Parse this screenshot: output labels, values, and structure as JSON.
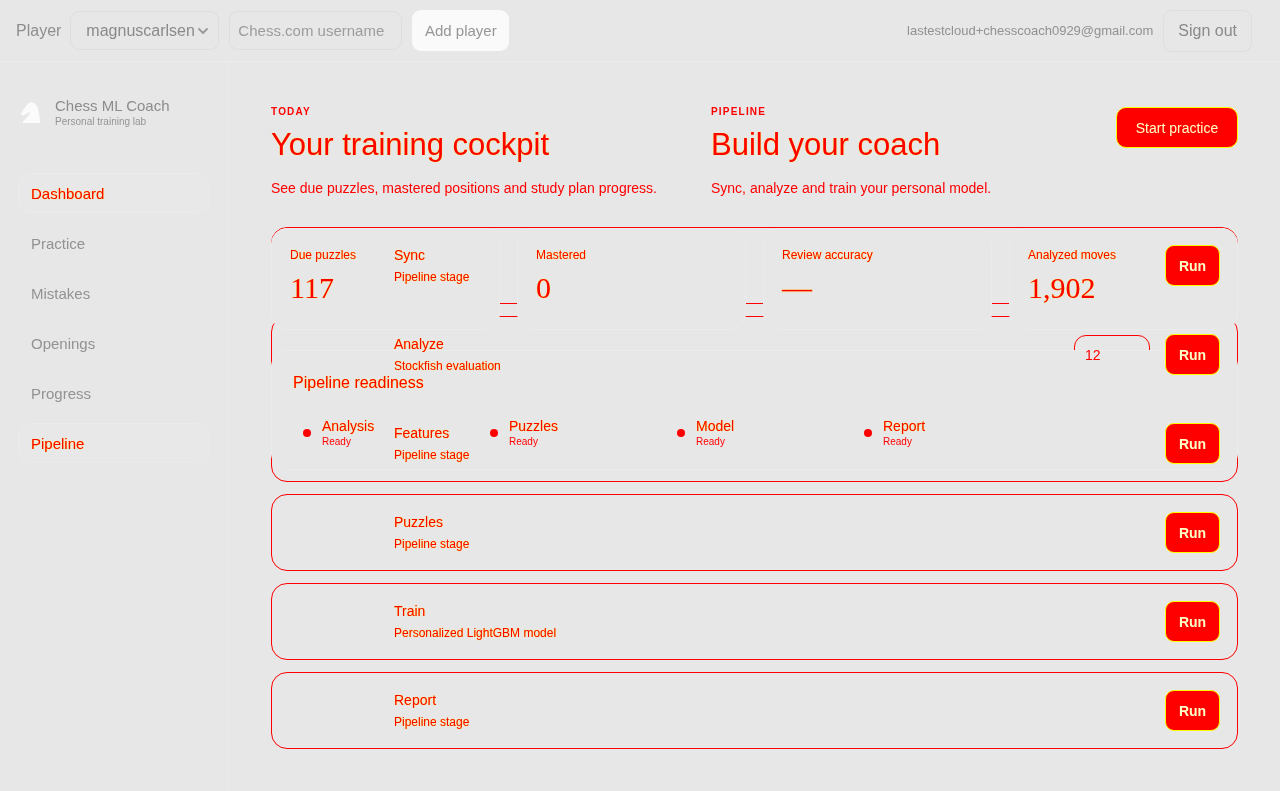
{
  "topbar": {
    "player_label": "Player",
    "player_select": {
      "value": "magnuscarlsen"
    },
    "username_field": {
      "placeholder": "Chess.com username"
    },
    "add_button": "Add player",
    "account_email": "lastestcloud+chesscoach0929@gmail.com",
    "sign_out_button": "Sign out"
  },
  "sidebar": {
    "brand": {
      "name": "Chess ML Coach",
      "tagline": "Personal training lab"
    },
    "items": [
      {
        "label": "Dashboard",
        "selected": true
      },
      {
        "label": "Practice",
        "selected": false
      },
      {
        "label": "Mistakes",
        "selected": false
      },
      {
        "label": "Openings",
        "selected": false
      },
      {
        "label": "Progress",
        "selected": false
      },
      {
        "label": "Pipeline",
        "selected": true
      }
    ]
  },
  "pipeline_view": {
    "eyebrow": "PIPELINE",
    "title": "Build your coach",
    "subtitle": "Sync, analyze and train your personal model.",
    "stages": [
      {
        "name": "Sync",
        "description": "Pipeline stage",
        "button": "Run"
      },
      {
        "name": "Analyze",
        "description": "Stockfish evaluation",
        "badge": "12",
        "button": "Run"
      },
      {
        "name": "Features",
        "description": "Pipeline stage",
        "button": "Run"
      },
      {
        "name": "Puzzles",
        "description": "Pipeline stage",
        "button": "Run"
      },
      {
        "name": "Train",
        "description": "Personalized LightGBM model",
        "button": "Run"
      },
      {
        "name": "Report",
        "description": "Pipeline stage",
        "button": "Run"
      }
    ]
  },
  "dashboard_view": {
    "eyebrow": "TODAY",
    "title": "Your training cockpit",
    "subtitle": "See due puzzles, mastered positions and study plan progress.",
    "primary_button": "Start practice",
    "stats": [
      {
        "label": "Due puzzles",
        "value": "117"
      },
      {
        "label": "Mastered",
        "value": "0"
      },
      {
        "label": "Review accuracy",
        "value": "—"
      },
      {
        "label": "Analyzed moves",
        "value": "1,902"
      }
    ],
    "readiness": {
      "title": "Pipeline readiness",
      "items": [
        {
          "name": "Analysis",
          "status": "Ready"
        },
        {
          "name": "Puzzles",
          "status": "Ready"
        },
        {
          "name": "Model",
          "status": "Ready"
        },
        {
          "name": "Report",
          "status": "Ready"
        }
      ]
    }
  }
}
